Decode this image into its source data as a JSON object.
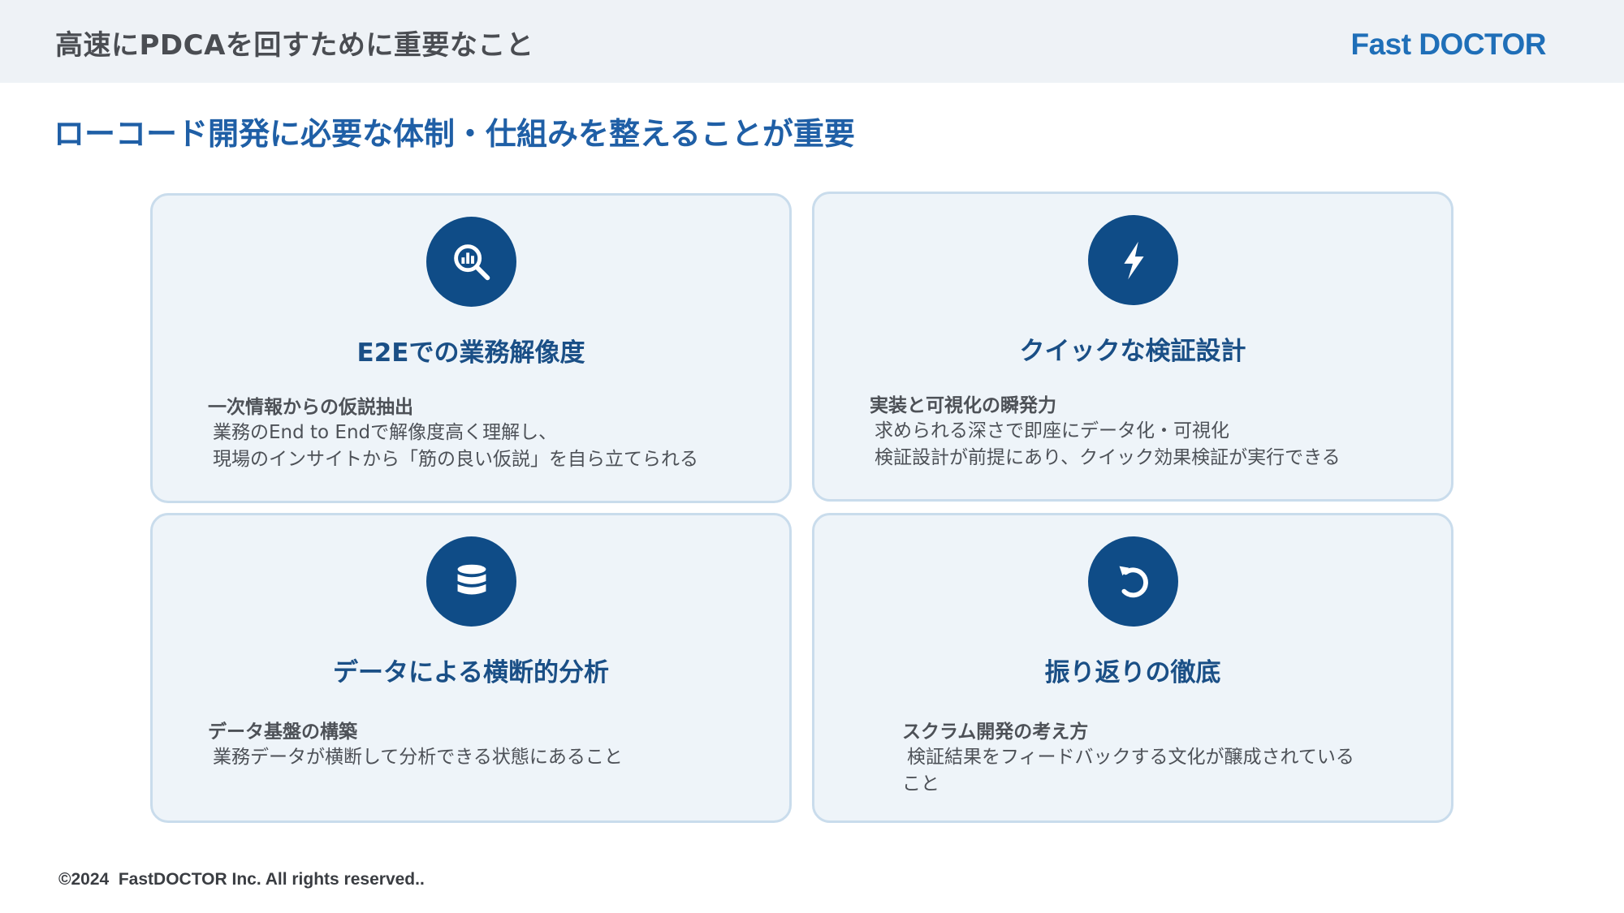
{
  "header": {
    "title": "高速にPDCAを回すために重要なこと",
    "brand": "Fast DOCTOR"
  },
  "subtitle": "ローコード開発に必要な体制・仕組みを整えることが重要",
  "cards": [
    {
      "icon": "chart-search-icon",
      "title": "E2Eでの業務解像度",
      "heading": "一次情報からの仮説抽出",
      "lines": [
        "業務のEnd to Endで解像度高く理解し、",
        "現場のインサイトから「筋の良い仮説」を自ら立てられる"
      ]
    },
    {
      "icon": "lightning-bolt-icon",
      "title": "クイックな検証設計",
      "heading": "実装と可視化の瞬発力",
      "lines": [
        "求められる深さで即座にデータ化・可視化",
        "検証設計が前提にあり、クイック効果検証が実行できる"
      ]
    },
    {
      "icon": "database-icon",
      "title": "データによる横断的分析",
      "heading": "データ基盤の構築",
      "lines": [
        "業務データが横断して分析できる状態にあること"
      ]
    },
    {
      "icon": "rotate-arrow-icon",
      "title": "振り返りの徹底",
      "heading": "スクラム開発の考え方",
      "lines": [
        "検証結果をフィードバックする文化が醸成されている",
        "こと"
      ]
    }
  ],
  "footer": "©2024  FastDOCTOR Inc. All rights reserved..",
  "colors": {
    "accent": "#1f5fa6",
    "icon_bg": "#0f4c87",
    "card_bg": "#eef4f9",
    "card_border": "#c9dcec",
    "header_bg": "#eef2f6"
  }
}
